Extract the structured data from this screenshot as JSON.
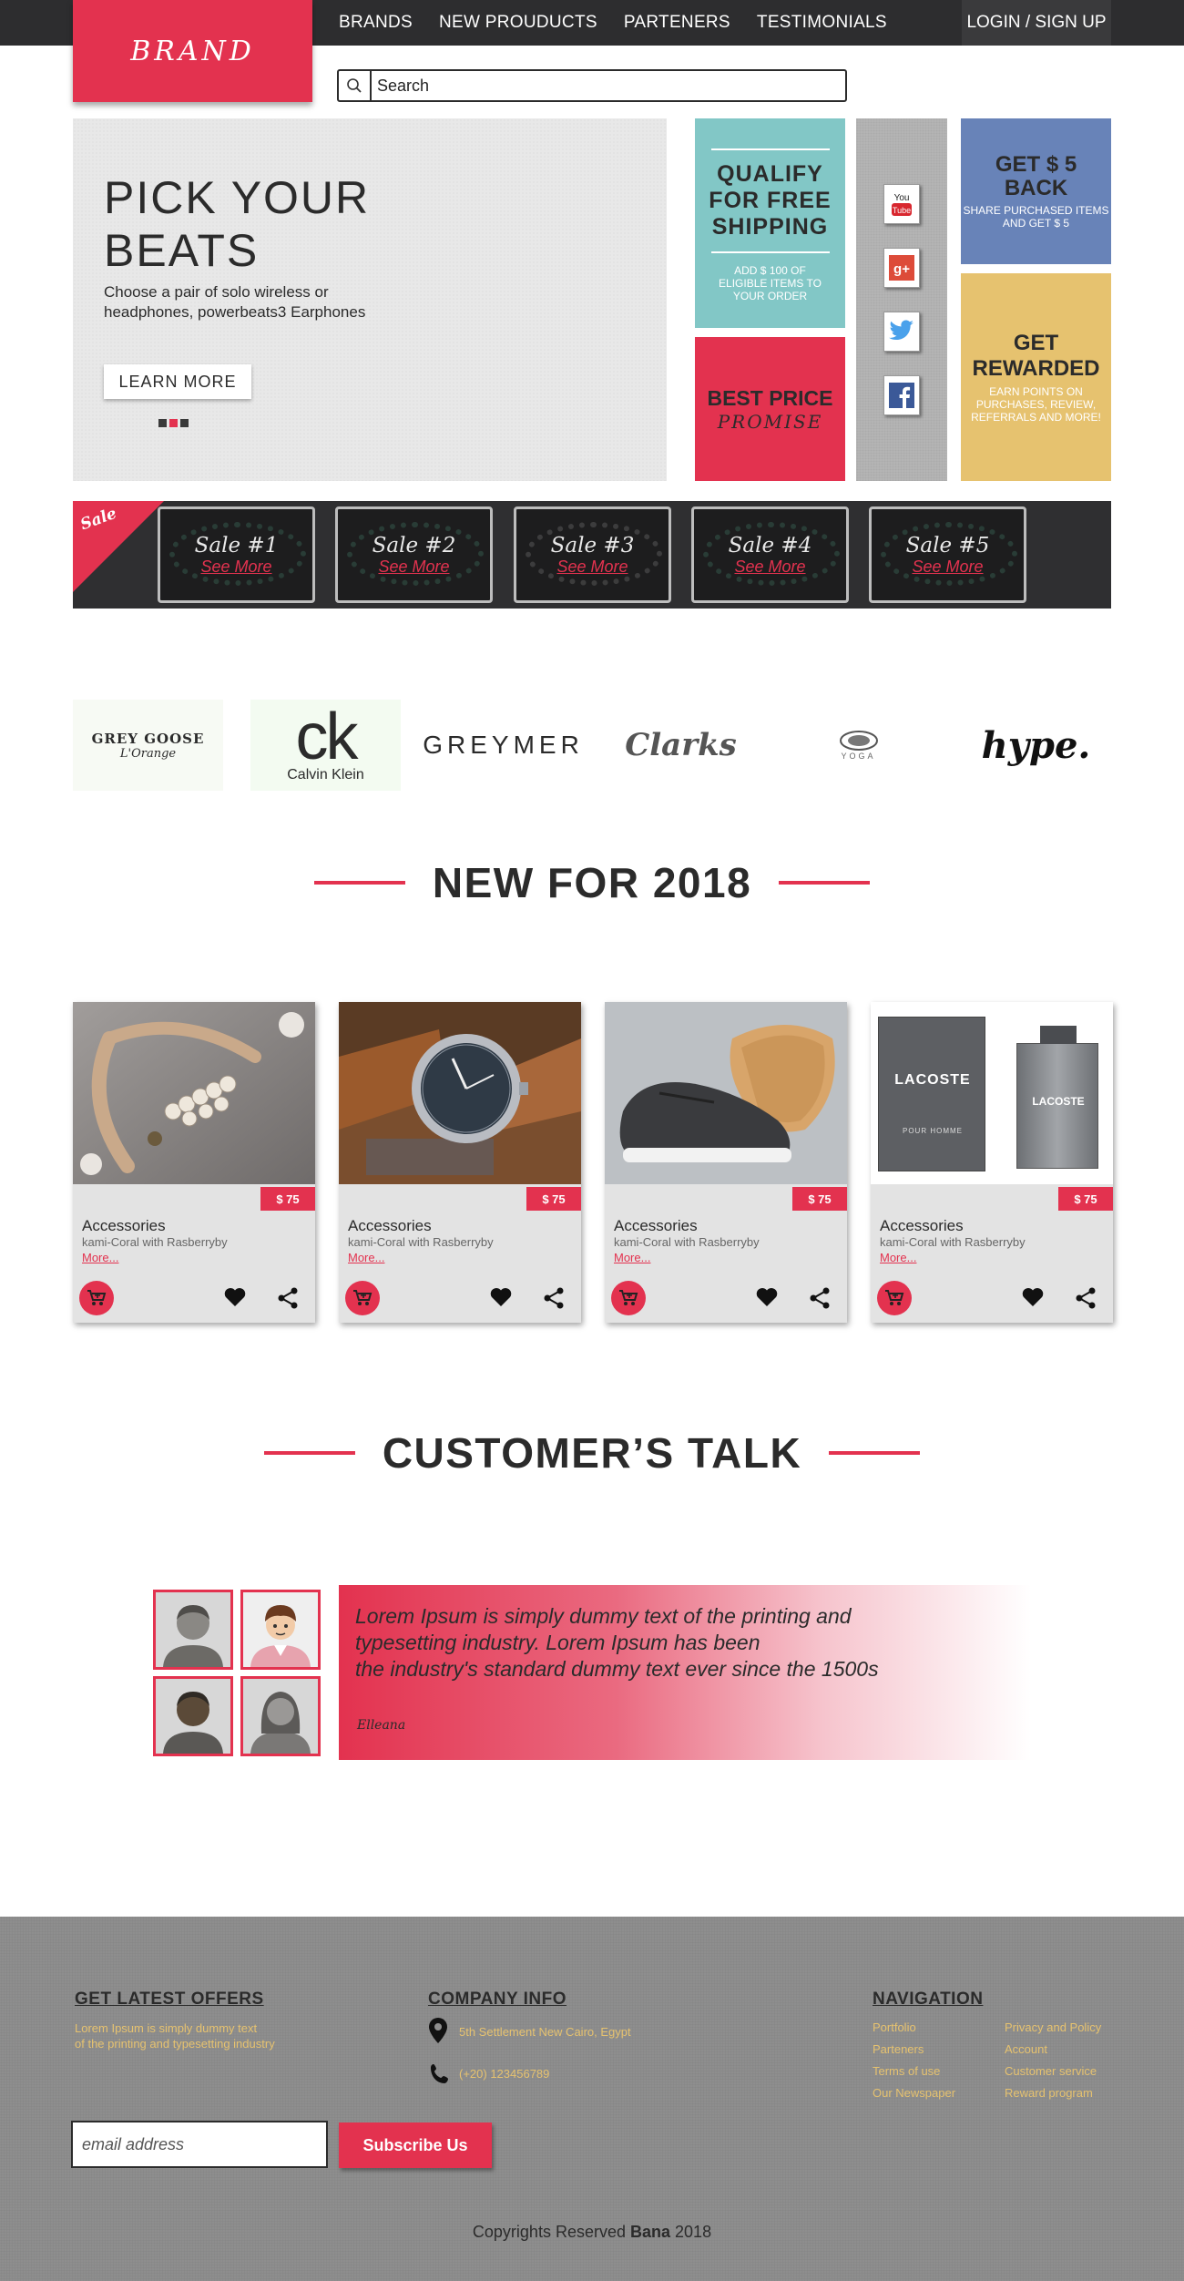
{
  "header": {
    "brand": "BRAND",
    "nav": [
      "BRANDS",
      "NEW PROUDUCTS",
      "PARTENERS",
      "TESTIMONIALS"
    ],
    "login": "LOGIN / SIGN UP"
  },
  "search": {
    "placeholder": "Search"
  },
  "hero": {
    "title": "PICK YOUR BEATS",
    "text": "Choose a pair of solo wireless or headphones, powerbeats3 Earphones",
    "button": "LEARN MORE",
    "slides": 3,
    "active_slide": 2
  },
  "promos": {
    "shipping": {
      "title": "QUALIFY FOR FREE SHIPPING",
      "text": "ADD $ 100 OF ELIGIBLE ITEMS TO YOUR ORDER"
    },
    "best_price": {
      "title": "BEST PRICE",
      "script": "PROMISE"
    },
    "social": [
      "youtube-icon",
      "google-plus-icon",
      "twitter-icon",
      "facebook-icon"
    ],
    "cashback": {
      "title": "GET $ 5 BACK",
      "text": "SHARE PURCHASED ITEMS AND GET $ 5"
    },
    "rewarded": {
      "title": "GET REWARDED",
      "text": "EARN POINTS ON PURCHASES, REVIEW, REFERRALS AND MORE!"
    }
  },
  "sale": {
    "label": "Sale",
    "items": [
      {
        "title": "Sale #1",
        "link": "See More"
      },
      {
        "title": "Sale #2",
        "link": "See More"
      },
      {
        "title": "Sale #3",
        "link": "See More"
      },
      {
        "title": "Sale #4",
        "link": "See More"
      },
      {
        "title": "Sale #5",
        "link": "See More"
      }
    ]
  },
  "brands": {
    "grey_goose": {
      "name": "GREY GOOSE",
      "sub": "L'Orange"
    },
    "ck": {
      "mark": "ck",
      "name": "Calvin Klein"
    },
    "greymer": "GREYMER",
    "clarks": "Clarks",
    "yoga": "YOGA",
    "hype": "hype."
  },
  "new_section": {
    "title": "NEW FOR 2018"
  },
  "products": [
    {
      "price": "$ 75",
      "category": "Accessories",
      "name": "kami-Coral with Rasberryby",
      "more": "More..."
    },
    {
      "price": "$ 75",
      "category": "Accessories",
      "name": "kami-Coral with Rasberryby",
      "more": "More..."
    },
    {
      "price": "$ 75",
      "category": "Accessories",
      "name": "kami-Coral with Rasberryby",
      "more": "More..."
    },
    {
      "price": "$ 75",
      "category": "Accessories",
      "name": "kami-Coral with Rasberryby",
      "more": "More..."
    }
  ],
  "product_images": {
    "perfume_brand": "LACOSTE",
    "perfume_sub": "POUR HOMME"
  },
  "talk_section": {
    "title": "CUSTOMER’S TALK",
    "quote_line1": "Lorem Ipsum is simply dummy text of the printing and",
    "quote_line2": "typesetting industry. Lorem Ipsum has been",
    "quote_line3": "the industry's standard dummy text ever since the 1500s",
    "signature": "Elleana"
  },
  "footer": {
    "offers": {
      "heading": "GET LATEST OFFERS",
      "line1": "Lorem Ipsum is simply dummy text",
      "line2": "of the printing and typesetting industry"
    },
    "company": {
      "heading": "COMPANY INFO",
      "address": "5th Settlement New Cairo, Egypt",
      "phone": "(+20) 123456789"
    },
    "navigation": {
      "heading": "NAVIGATION",
      "col1": [
        "Portfolio",
        "Parteners",
        "Terms of use",
        "Our Newspaper"
      ],
      "col2": [
        "Privacy and Policy",
        "Account",
        "Customer service",
        "Reward program"
      ]
    },
    "email_placeholder": "email address",
    "subscribe": "Subscribe Us",
    "copyright_prefix": "Copyrights Reserved",
    "copyright_name": "Bana",
    "copyright_year": "2018"
  },
  "colors": {
    "accent": "#e3324f",
    "teal": "#82c7c6",
    "blue": "#6883b8",
    "gold": "#e6c26f",
    "dark": "#2d2d2f"
  }
}
